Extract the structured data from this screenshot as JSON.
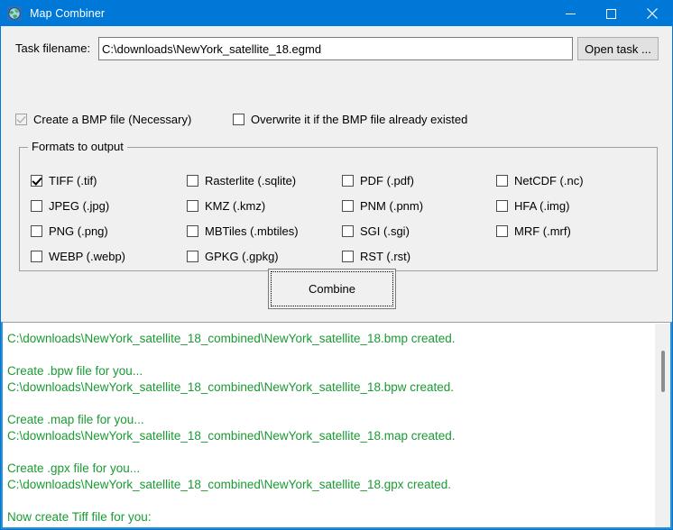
{
  "window": {
    "title": "Map Combiner",
    "icon": "map-globe-icon",
    "accent_color": "#0078d7",
    "minimize_label": "Minimize",
    "maximize_label": "Maximize",
    "close_label": "Close"
  },
  "task": {
    "label": "Task filename:",
    "value": "C:\\downloads\\NewYork_satellite_18.egmd",
    "placeholder": "",
    "open_button": "Open task ..."
  },
  "options": [
    {
      "label": "Create a  BMP file (Necessary)",
      "checked": true,
      "disabled": true,
      "name": "create-bmp-checkbox"
    },
    {
      "label": "Overwrite it if the BMP file already existed",
      "checked": false,
      "disabled": false,
      "name": "overwrite-bmp-checkbox"
    }
  ],
  "formats_group": {
    "title": "Formats to output",
    "items": [
      {
        "label": "TIFF (.tif)",
        "checked": true,
        "name": "format-tiff-checkbox"
      },
      {
        "label": "JPEG (.jpg)",
        "checked": false,
        "name": "format-jpeg-checkbox"
      },
      {
        "label": "PNG (.png)",
        "checked": false,
        "name": "format-png-checkbox"
      },
      {
        "label": "WEBP (.webp)",
        "checked": false,
        "name": "format-webp-checkbox"
      },
      {
        "label": "Rasterlite (.sqlite)",
        "checked": false,
        "name": "format-rasterlite-checkbox"
      },
      {
        "label": "KMZ (.kmz)",
        "checked": false,
        "name": "format-kmz-checkbox"
      },
      {
        "label": "MBTiles (.mbtiles)",
        "checked": false,
        "name": "format-mbtiles-checkbox"
      },
      {
        "label": "GPKG (.gpkg)",
        "checked": false,
        "name": "format-gpkg-checkbox"
      },
      {
        "label": "PDF (.pdf)",
        "checked": false,
        "name": "format-pdf-checkbox"
      },
      {
        "label": "PNM (.pnm)",
        "checked": false,
        "name": "format-pnm-checkbox"
      },
      {
        "label": "SGI (.sgi)",
        "checked": false,
        "name": "format-sgi-checkbox"
      },
      {
        "label": "RST (.rst)",
        "checked": false,
        "name": "format-rst-checkbox"
      },
      {
        "label": "NetCDF (.nc)",
        "checked": false,
        "name": "format-netcdf-checkbox"
      },
      {
        "label": "HFA (.img)",
        "checked": false,
        "name": "format-hfa-checkbox"
      },
      {
        "label": "MRF (.mrf)",
        "checked": false,
        "name": "format-mrf-checkbox"
      }
    ]
  },
  "combine_button": {
    "label": "Combine",
    "focused": true
  },
  "log": {
    "text_color": "#1a9a33",
    "content": "C:\\downloads\\NewYork_satellite_18_combined\\NewYork_satellite_18.bmp created.\n\nCreate .bpw file for you...\nC:\\downloads\\NewYork_satellite_18_combined\\NewYork_satellite_18.bpw created.\n\nCreate .map file for you...\nC:\\downloads\\NewYork_satellite_18_combined\\NewYork_satellite_18.map created.\n\nCreate .gpx file for you...\nC:\\downloads\\NewYork_satellite_18_combined\\NewYork_satellite_18.gpx created.\n\nNow create Tiff file for you:"
  }
}
